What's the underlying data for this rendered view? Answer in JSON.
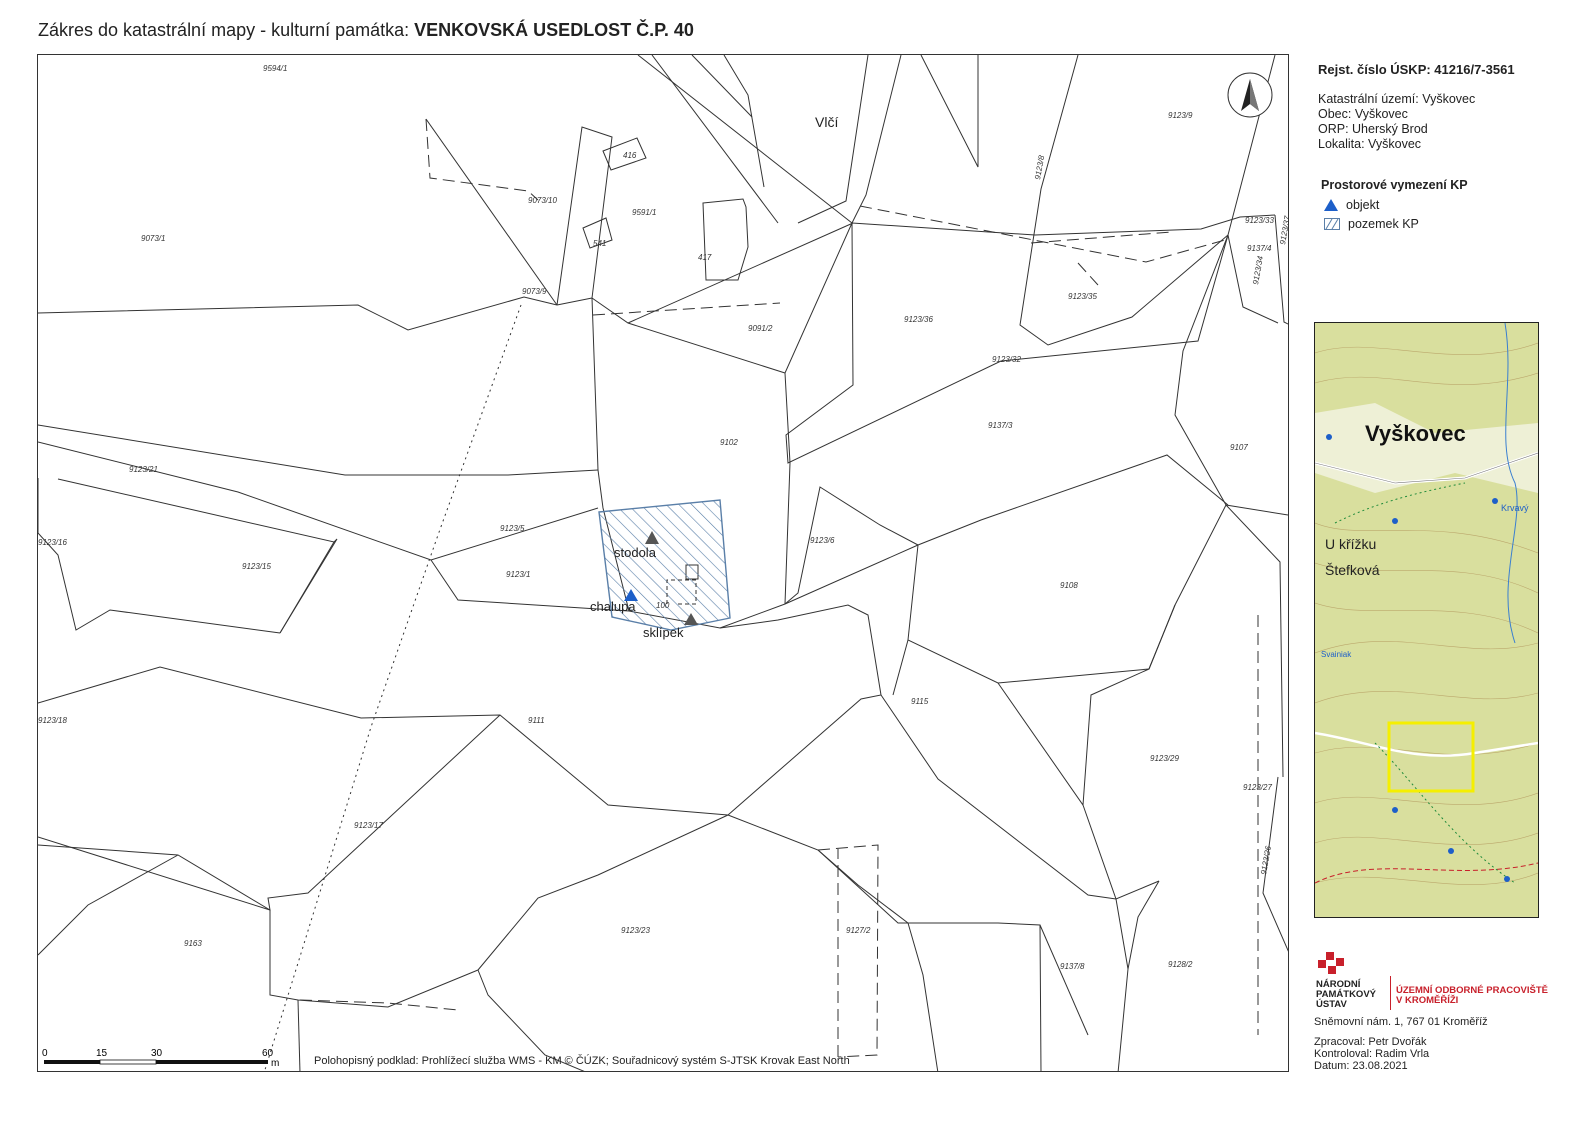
{
  "title": {
    "prefix": "Zákres do katastrální mapy - kulturní památka: ",
    "name": "VENKOVSKÁ USEDLOST Č.P. 40"
  },
  "sidebar": {
    "registry": "Rejst. číslo ÚSKP:  41216/7-3561",
    "info": [
      "Katastrální území: Vyškovec",
      "Obec: Vyškovec",
      "ORP:  Uherský Brod",
      "Lokalita: Vyškovec"
    ],
    "legend_title": "Prostorové vymezení KP",
    "legend": [
      {
        "label": "objekt",
        "symbol": "triangle",
        "color": "#1d5fc9"
      },
      {
        "label": "pozemek KP",
        "symbol": "hatched-box",
        "color": "#5a7fa8"
      }
    ],
    "locator": {
      "place_name": "Vyškovec",
      "labels": [
        "U křížku",
        "Štefková",
        "Krvavý",
        "Svainiak"
      ],
      "highlight_color": "#f5ef00"
    },
    "institution": {
      "left": [
        "NÁRODNÍ",
        "PAMÁTKOVÝ",
        "ÚSTAV"
      ],
      "right": [
        "ÚZEMNÍ ODBORNÉ PRACOVIŠTĚ",
        "V KROMĚŘÍŽI"
      ],
      "accent_color": "#c8202b"
    },
    "address": "Sněmovní nám. 1, 767 01 Kroměříž",
    "credits": [
      "Zpracoval: Petr Dvořák",
      "Kontroloval: Radim Vrla",
      "Datum: 23.08.2021"
    ]
  },
  "map": {
    "village_label": "Vlčí",
    "objects": [
      {
        "label": "stodola",
        "color": "#555555"
      },
      {
        "label": "chalupa",
        "color": "#1d5fc9",
        "label_color": "#c0282d"
      },
      {
        "label": "sklípek",
        "color": "#555555"
      }
    ],
    "parcels": [
      "9594/1",
      "9073/10",
      "9591/1",
      "9073/1",
      "9073/9",
      "416",
      "541",
      "417",
      "9091/2",
      "9123/36",
      "9123/35",
      "9123/33",
      "9137/4",
      "9123/34",
      "9123/37",
      "9123/32",
      "9123/9",
      "9123/8",
      "Vlčí",
      "9102",
      "9137/3",
      "9107",
      "9123/21",
      "9123/5",
      "9123/1",
      "9123/16",
      "9123/15",
      "9123/6",
      "9108",
      "100",
      "9111",
      "9115",
      "9123/29",
      "9123/18",
      "9123/17",
      "9123/27",
      "9123/26",
      "9163",
      "9123/23",
      "9127/2",
      "9137/8",
      "9128/2"
    ],
    "scale": {
      "ticks": [
        "0",
        "15",
        "30",
        "60"
      ],
      "unit": "m"
    },
    "attribution": "Polohopisný podklad: Prohlížecí služba WMS - KM © ČÚZK;  Souřadnicový systém S-JTSK Krovak East North"
  }
}
